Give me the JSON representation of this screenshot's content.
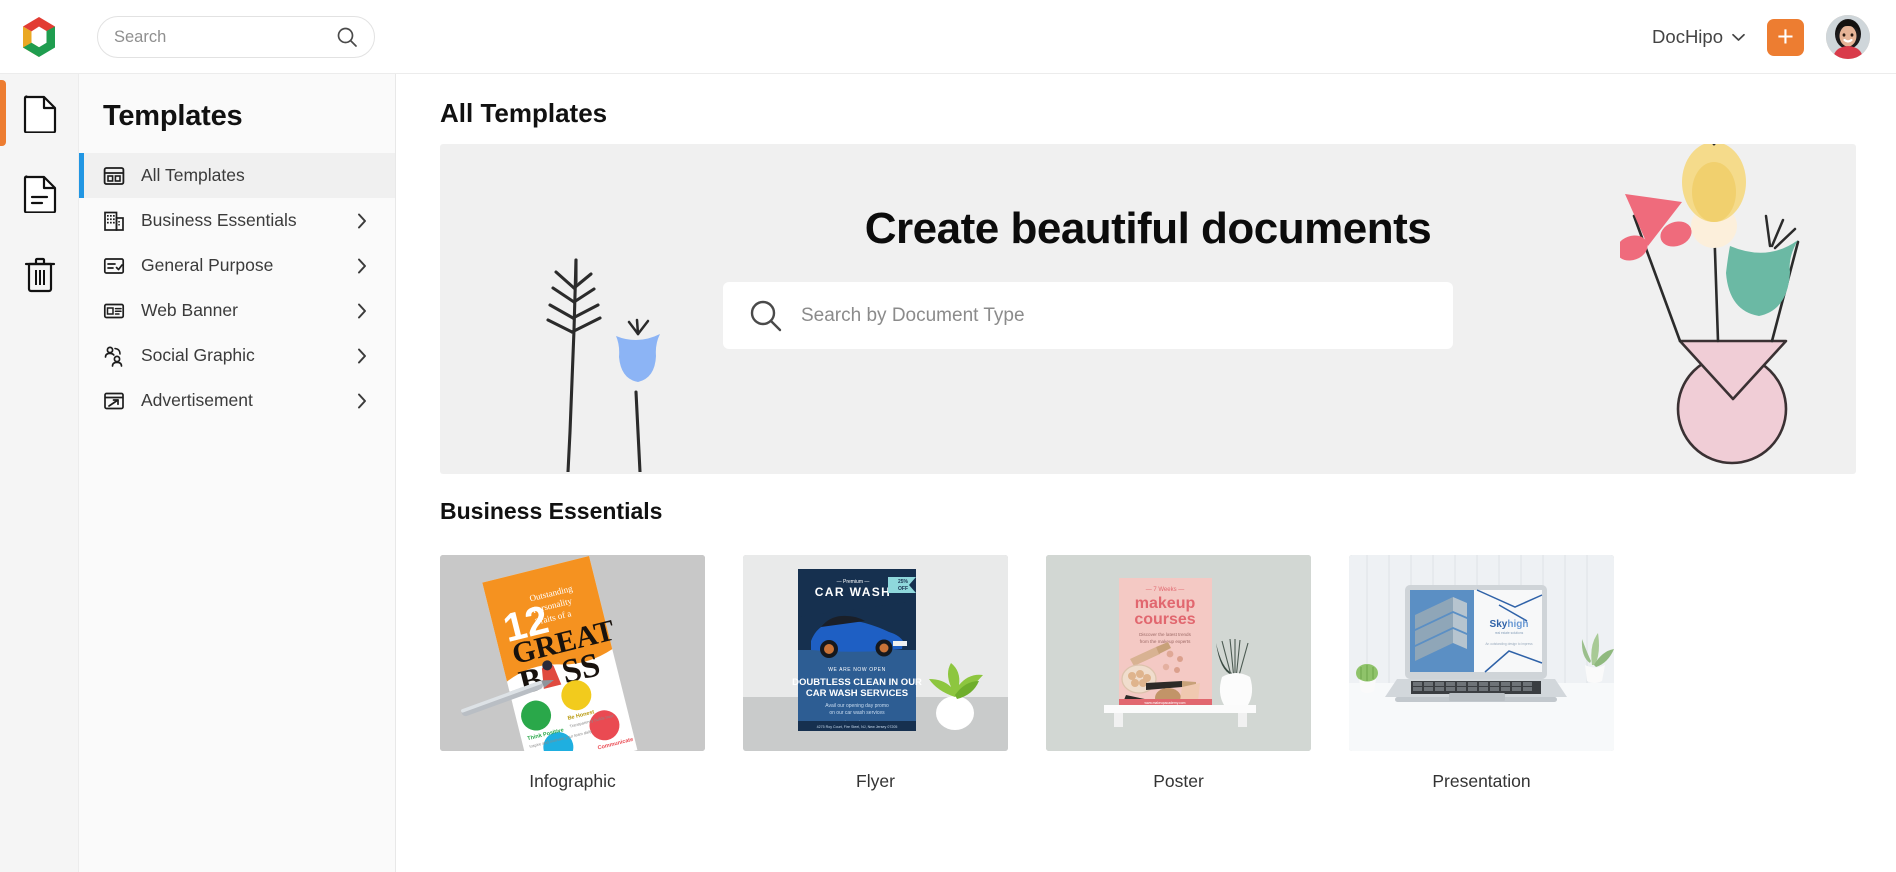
{
  "topbar": {
    "search": {
      "value": "",
      "placeholder": "Search",
      "icon": "search-icon"
    },
    "account_name": "DocHipo",
    "chevron_icon": "chevron-down-icon",
    "add_button_label": "+",
    "avatar_alt": "user-avatar"
  },
  "rail": {
    "items": [
      {
        "icon": "blank-document-icon",
        "active": true
      },
      {
        "icon": "document-lines-icon",
        "active": false
      },
      {
        "icon": "trash-icon",
        "active": false
      }
    ]
  },
  "sidebar": {
    "title": "Templates",
    "items": [
      {
        "label": "All Templates",
        "icon": "grid-layout-icon",
        "has_chevron": false,
        "active": true
      },
      {
        "label": "Business Essentials",
        "icon": "building-icon",
        "has_chevron": true,
        "active": false
      },
      {
        "label": "General Purpose",
        "icon": "checklist-icon",
        "has_chevron": true,
        "active": false
      },
      {
        "label": "Web Banner",
        "icon": "banner-icon",
        "has_chevron": true,
        "active": false
      },
      {
        "label": "Social Graphic",
        "icon": "people-icon",
        "has_chevron": true,
        "active": false
      },
      {
        "label": "Advertisement",
        "icon": "ad-window-icon",
        "has_chevron": true,
        "active": false
      }
    ]
  },
  "main": {
    "page_title": "All Templates",
    "hero": {
      "heading": "Create beautiful documents",
      "search": {
        "value": "",
        "placeholder": "Search by Document Type",
        "icon": "search-icon"
      },
      "art_left": "branch-and-blue-flower-illustration",
      "art_right": "vase-with-flowers-illustration",
      "background_color": "#f0f0f0"
    },
    "section": {
      "title": "Business Essentials",
      "cards": [
        {
          "label": "Infographic",
          "thumb": "orange-great-boss-infographic-brochure-with-pen"
        },
        {
          "label": "Flyer",
          "thumb": "blue-car-wash-flyer-with-plant"
        },
        {
          "label": "Poster",
          "thumb": "pink-makeup-courses-poster-on-shelf"
        },
        {
          "label": "Presentation",
          "thumb": "laptop-skyhigh-presentation-with-plants"
        }
      ]
    }
  },
  "colors": {
    "accent_orange": "#ed7d31",
    "accent_blue": "#2196e3",
    "hero_gray": "#f0f0f0",
    "sidebar_gray": "#fafafa"
  }
}
